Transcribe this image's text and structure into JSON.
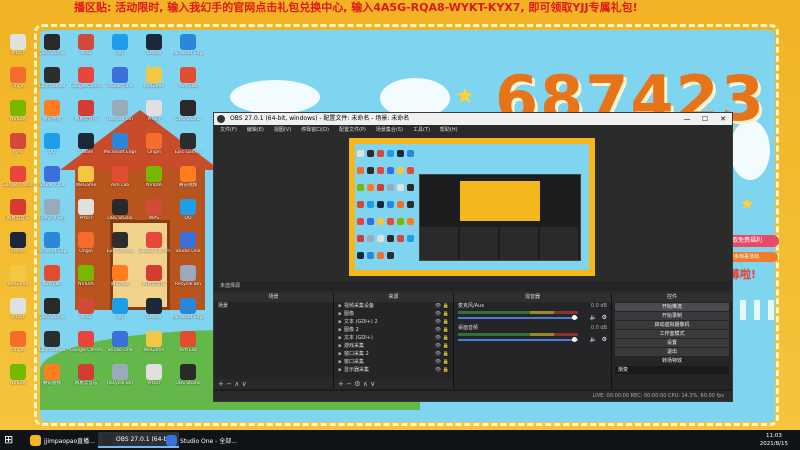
{
  "marquee": "播区贴: 活动限时, 输入我幻手的官网点击礼包兑换中心, 输入4A5G-RQA8-WYKT-KYX7, 即可领取YJJ专属礼包!",
  "wallpaper": {
    "room_number": "687423",
    "ribbon_top": "进入直播间领取免费福利",
    "ribbon_bottom": "扫码关注获取更多惊喜活动",
    "room_tag": "房管招募啦!"
  },
  "desktop_icons": [
    {
      "label": "Prtscr",
      "color": "#e0e0e0"
    },
    {
      "label": "OBS Studio",
      "color": "#2a2a2a"
    },
    {
      "label": "WPS",
      "color": "#d24b3a"
    },
    {
      "label": "QQ",
      "color": "#1e9de8"
    },
    {
      "label": "Steam",
      "color": "#1b2838"
    },
    {
      "label": "Microsoft Edge",
      "color": "#2b88d8"
    },
    {
      "label": "Origin",
      "color": "#f56c2d"
    },
    {
      "label": "Epic Games",
      "color": "#2d2d2d"
    },
    {
      "label": "Google Chrome",
      "color": "#e8453c"
    },
    {
      "label": "Studio One",
      "color": "#3b6fd9"
    },
    {
      "label": "WeGame",
      "color": "#f2c744"
    },
    {
      "label": "Aim Lab",
      "color": "#e24c2f"
    },
    {
      "label": "NVIDIA",
      "color": "#76b900"
    },
    {
      "label": "腾讯视频",
      "color": "#ff7d1f"
    },
    {
      "label": "网易云音乐",
      "color": "#d43c33"
    },
    {
      "label": "Recycle Bin",
      "color": "#9ab"
    }
  ],
  "obs": {
    "title": "OBS 27.0.1 (64-bit, windows) - 配置文件: 未命名 - 场景: 未命名",
    "window_controls": [
      "—",
      "☐",
      "✕"
    ],
    "menu": [
      "文件(F)",
      "编辑(E)",
      "视图(V)",
      "停靠窗口(D)",
      "配置文件(P)",
      "场景集合(S)",
      "工具(T)",
      "帮助(H)"
    ],
    "source_bar": "未选择源",
    "docks": {
      "scenes": {
        "header": "场景",
        "items": [
          "场景"
        ]
      },
      "sources": {
        "header": "来源",
        "items": [
          "视频采集设备",
          "图像",
          "文本 (GDI+) 2",
          "图像 2",
          "文本 (GDI+)",
          "游戏采集",
          "窗口采集 2",
          "窗口采集",
          "显示器采集"
        ]
      },
      "mixer": {
        "header": "混音器",
        "channels": [
          {
            "name": "麦克风/Aux",
            "db": "0.0 dB"
          },
          {
            "name": "桌面音频",
            "db": "0.0 dB"
          }
        ]
      },
      "controls": {
        "header": "控件",
        "buttons": [
          "开始推流",
          "开始录制",
          "启动虚拟摄像机",
          "工作室模式",
          "设置",
          "退出"
        ],
        "transitions_label": "转场特效",
        "transition_value": "渐变"
      }
    },
    "status": "LIVE: 00:00:00   REC: 00:00:00   CPU: 14.3%, 60.00 fps"
  },
  "taskbar": {
    "items": [
      {
        "label": "jjimpaopao直播...",
        "color": "#f4b71d"
      },
      {
        "label": "OBS 27.0.1 (64-bi...",
        "color": "#2a2a2a",
        "active": true
      },
      {
        "label": "Studio One - 全部...",
        "color": "#3b6fd9"
      }
    ],
    "time": "11:03",
    "date": "2021/8/15"
  }
}
